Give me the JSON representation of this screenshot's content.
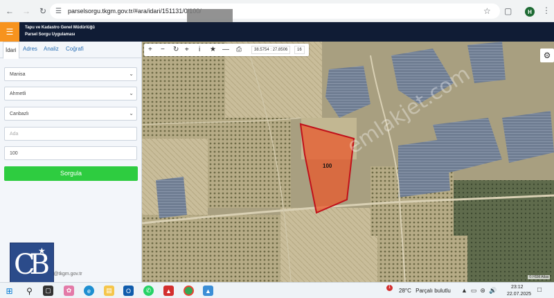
{
  "browser": {
    "url": "parselsorgu.tkgm.gov.tr/#ara/idari/151131/0/100/",
    "profile_initial": "H"
  },
  "header": {
    "org_name": "Tapu ve Kadastro Genel Müdürlüğü",
    "app_name": "Parsel Sorgu Uygulaması"
  },
  "sidebar": {
    "tabs": [
      "İdari",
      "Adres",
      "Analiz",
      "Coğrafi"
    ],
    "province": "Manisa",
    "district": "Ahmetli",
    "neighborhood": "Canbazlı",
    "block_placeholder": "Ada",
    "parcel_value": "100",
    "query_button": "Sorgula",
    "footer_email": "bs@tkgm.gov.tr"
  },
  "map": {
    "coordinates": "38.5754 : 27.8506",
    "zoom_level": "16",
    "parcel_label": "100",
    "watermark": "emlakjet.com",
    "attribution": "© HSM Atlas"
  },
  "taskbar": {
    "weather_temp": "28°C",
    "weather_desc": "Parçalı bulutlu",
    "weather_badge": "1",
    "time": "23:12",
    "date": "22.07.2025"
  },
  "logo": {
    "text": "CB",
    "colors": {
      "background": "#2b4b8a",
      "text": "#ffffff"
    }
  },
  "colors": {
    "header_bg": "#101c35",
    "hamburger_bg": "#f7931e",
    "query_button_bg": "#2ecc40",
    "parcel_fill": "#e85a2c",
    "parcel_stroke": "#c0101a"
  }
}
